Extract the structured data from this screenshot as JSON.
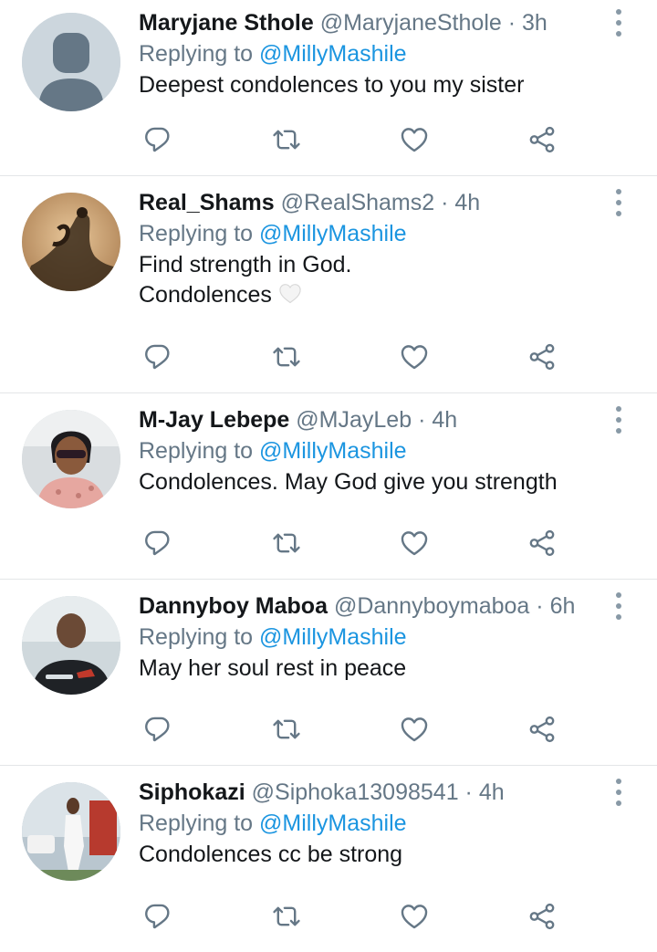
{
  "tweets": [
    {
      "name": "Maryjane Sthole",
      "handle": "@MaryjaneSthole",
      "sep": "·",
      "time": "3h",
      "replying_prefix": "Replying to ",
      "replying_to": "@MillyMashile",
      "lines": [
        "Deepest condolences to you my sister"
      ],
      "avatar": "default-avatar"
    },
    {
      "name": "Real_Shams",
      "handle": "@RealShams2",
      "sep": "·",
      "time": "4h",
      "replying_prefix": "Replying to ",
      "replying_to": "@MillyMashile",
      "lines": [
        "Find strength in God.",
        "Condolences"
      ],
      "emoji": "white-heart-icon",
      "avatar": "photo-avatar"
    },
    {
      "name": "M-Jay Lebepe",
      "handle": "@MJayLeb",
      "sep": "·",
      "time": "4h",
      "replying_prefix": "Replying to ",
      "replying_to": "@MillyMashile",
      "lines": [
        "Condolences. May God give you strength"
      ],
      "avatar": "photo-avatar"
    },
    {
      "name": "Dannyboy Maboa",
      "handle": "@Dannyboymaboa",
      "sep": "·",
      "time": "6h",
      "replying_prefix": "Replying to ",
      "replying_to": "@MillyMashile",
      "lines": [
        "May her soul rest in peace"
      ],
      "avatar": "photo-avatar"
    },
    {
      "name": "Siphokazi",
      "handle": "@Siphoka13098541",
      "sep": "·",
      "time": "4h",
      "replying_prefix": "Replying to ",
      "replying_to": "@MillyMashile",
      "lines": [
        "Condolences cc be strong"
      ],
      "avatar": "photo-avatar"
    }
  ],
  "colors": {
    "accent": "#1b95e0",
    "secondary_text": "#657786",
    "icon": "#657786",
    "divider": "#e3e6e8"
  },
  "icons": [
    "reply-icon",
    "retweet-icon",
    "like-icon",
    "share-icon",
    "more-icon"
  ]
}
